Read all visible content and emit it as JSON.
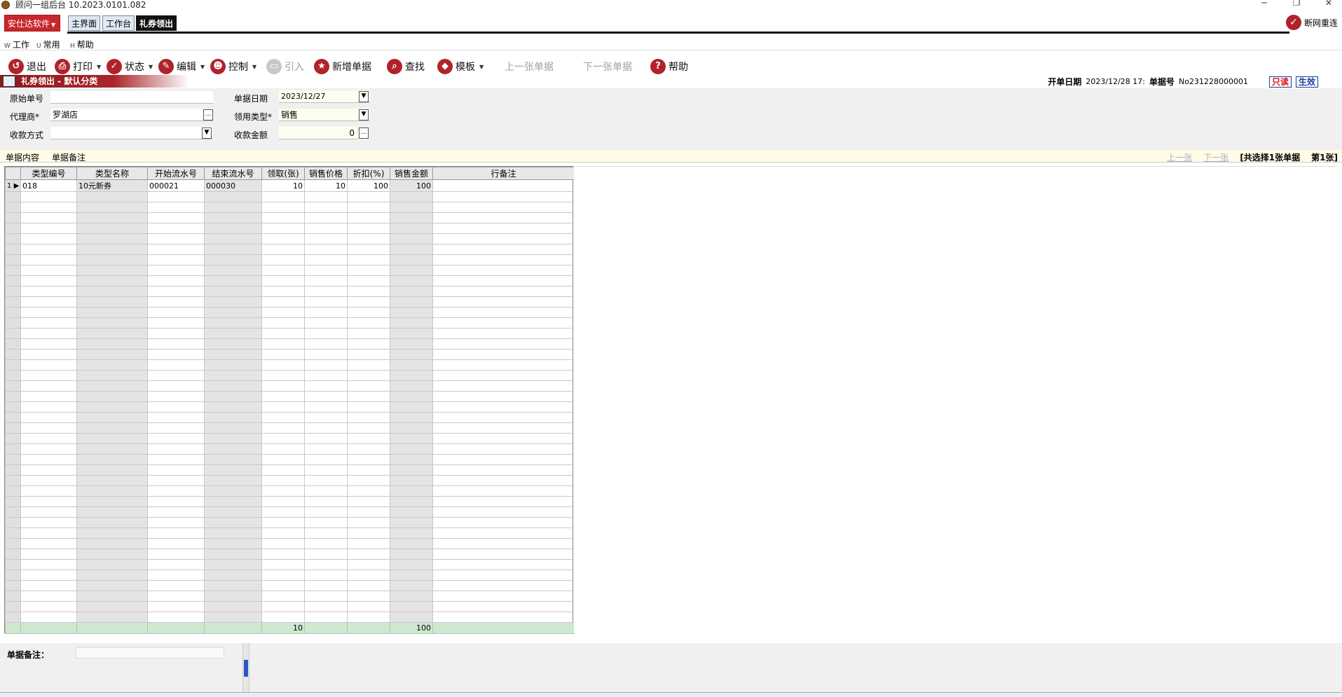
{
  "titlebar": {
    "title": "顾问一组后台    10.2023.0101.082",
    "minimize": "─",
    "restore": "❐",
    "close": "✕"
  },
  "topbar": {
    "brand": "安仕达软件",
    "tabs": [
      "主界面",
      "工作台",
      "礼券领出"
    ],
    "offline": "断网重连"
  },
  "menu": {
    "items": [
      {
        "mnem": "W",
        "label": "工作"
      },
      {
        "mnem": "U",
        "label": "常用"
      },
      {
        "mnem": "H",
        "label": "帮助"
      }
    ]
  },
  "toolbar": {
    "exit": "退出",
    "print": "打印",
    "status": "状态",
    "edit": "编辑",
    "control": "控制",
    "import": "引入",
    "new_doc": "新增单据",
    "find": "查找",
    "template": "模板",
    "prev_doc": "上一张单据",
    "next_doc": "下一张单据",
    "help": "帮助"
  },
  "form_header": {
    "title": "礼券领出 - 默认分类",
    "open_date_label": "开单日期",
    "open_date_value": "2023/12/28 17:",
    "doc_no_label": "单据号",
    "doc_no_value": "No231228000001",
    "badge_readonly": "只读",
    "badge_effective": "生效"
  },
  "form": {
    "orig_no_label": "原始单号",
    "orig_no_value": "",
    "agent_label": "代理商*",
    "agent_value": "罗湖店",
    "pay_method_label": "收款方式",
    "pay_method_value": "",
    "doc_date_label": "单据日期",
    "doc_date_value": "2023/12/27",
    "use_type_label": "领用类型*",
    "use_type_value": "销售",
    "pay_amount_label": "收款金额",
    "pay_amount_value": "0",
    "ellipsis": "...",
    "dropdown": "▼"
  },
  "subtabs": {
    "content": "单据内容",
    "remark": "单据备注",
    "prev": "上一张",
    "next": "下一张",
    "selected": "[共选择1张单据",
    "page": "第1张]"
  },
  "grid": {
    "columns": [
      "类型编号",
      "类型名称",
      "开始流水号",
      "结束流水号",
      "领取(张)",
      "销售价格",
      "折扣(%)",
      "销售金额",
      "行备注"
    ],
    "rows": [
      {
        "idx": "1",
        "marker": "▶",
        "type_no": "018",
        "type_name": "10元新券",
        "start_no": "000021",
        "end_no": "000030",
        "qty": "10",
        "price": "10",
        "discount": "100",
        "amount": "100",
        "remark": ""
      }
    ],
    "footer": {
      "qty": "10",
      "amount": "100"
    }
  },
  "bottom": {
    "remark_label": "单据备注："
  },
  "colors": {
    "accent_red": "#b0232a",
    "brand_red": "#c8262b",
    "footer_green": "#cfe8cf"
  }
}
